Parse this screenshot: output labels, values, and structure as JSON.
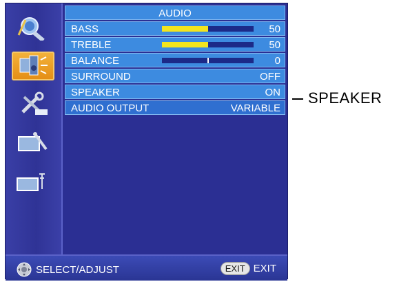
{
  "menu": {
    "title": "AUDIO",
    "rows": [
      {
        "label": "BASS",
        "value": "50",
        "level": 0.5
      },
      {
        "label": "TREBLE",
        "value": "50",
        "level": 0.5
      },
      {
        "label": "BALANCE",
        "value": "0",
        "level": 0.5
      },
      {
        "label": "SURROUND",
        "value": "OFF"
      },
      {
        "label": "SPEAKER",
        "value": "ON"
      },
      {
        "label": "AUDIO OUTPUT",
        "value": "VARIABLE"
      }
    ]
  },
  "sidebar": {
    "icons": [
      {
        "name": "picture-settings-icon",
        "active": false
      },
      {
        "name": "audio-settings-icon",
        "active": true
      },
      {
        "name": "tools-settings-icon",
        "active": false
      },
      {
        "name": "tv-setup-icon",
        "active": false
      },
      {
        "name": "antenna-channel-icon",
        "active": false
      }
    ]
  },
  "footer": {
    "select_label": "SELECT/ADJUST",
    "exit_button": "EXIT",
    "exit_label": "EXIT"
  },
  "callout": {
    "label": "SPEAKER"
  },
  "colors": {
    "osd_background": "#2b2f93",
    "row_background": "#3d8be0",
    "bar_fill": "#f3e51e",
    "active_icon": "#f3b33c"
  }
}
